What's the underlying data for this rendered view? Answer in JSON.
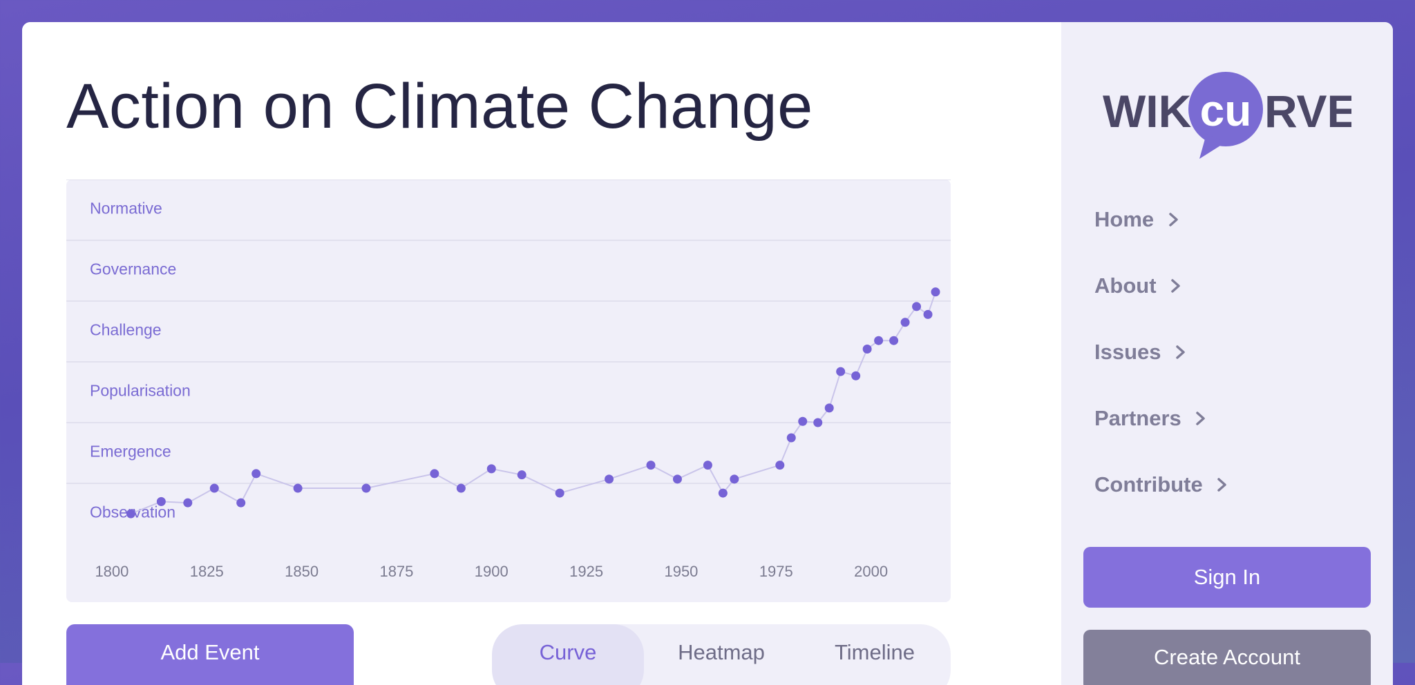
{
  "page": {
    "title": "Action on Climate Change"
  },
  "brand": {
    "logo_left": "WIKI",
    "logo_right": "RVE",
    "logo_mark": "cu",
    "accent": "#7a6bd3",
    "dark": "#4b4766"
  },
  "sidebar": {
    "nav": [
      {
        "label": "Home",
        "icon": "chevron-right-icon"
      },
      {
        "label": "About",
        "icon": "chevron-right-icon"
      },
      {
        "label": "Issues",
        "icon": "chevron-right-icon"
      },
      {
        "label": "Partners",
        "icon": "chevron-right-icon"
      },
      {
        "label": "Contribute",
        "icon": "chevron-right-icon"
      }
    ],
    "sign_in": "Sign In",
    "create_account": "Create Account"
  },
  "actions": {
    "add_event": "Add Event",
    "views": [
      "Curve",
      "Heatmap",
      "Timeline"
    ],
    "active_view": "Curve"
  },
  "chart_data": {
    "type": "line",
    "title": "",
    "xlabel": "",
    "ylabel": "",
    "xlim": [
      1788,
      2021
    ],
    "x_ticks": [
      1800,
      1825,
      1850,
      1875,
      1900,
      1925,
      1950,
      1975,
      2000
    ],
    "ylim": [
      -0.5,
      5.5
    ],
    "bands": [
      "Observation",
      "Emergence",
      "Popularisation",
      "Challenge",
      "Governance",
      "Normative"
    ],
    "grid": true,
    "series": [
      {
        "points": [
          [
            1805,
            0.0
          ],
          [
            1813,
            0.2
          ],
          [
            1820,
            0.18
          ],
          [
            1827,
            0.42
          ],
          [
            1834,
            0.18
          ],
          [
            1838,
            0.66
          ],
          [
            1849,
            0.42
          ],
          [
            1867,
            0.42
          ],
          [
            1885,
            0.66
          ],
          [
            1892,
            0.42
          ],
          [
            1900,
            0.74
          ],
          [
            1908,
            0.64
          ],
          [
            1918,
            0.34
          ],
          [
            1931,
            0.57
          ],
          [
            1942,
            0.8
          ],
          [
            1949,
            0.57
          ],
          [
            1957,
            0.8
          ],
          [
            1961,
            0.34
          ],
          [
            1964,
            0.57
          ],
          [
            1976,
            0.8
          ],
          [
            1979,
            1.25
          ],
          [
            1982,
            1.52
          ],
          [
            1986,
            1.5
          ],
          [
            1989,
            1.74
          ],
          [
            1992,
            2.34
          ],
          [
            1996,
            2.27
          ],
          [
            1999,
            2.71
          ],
          [
            2002,
            2.85
          ],
          [
            2006,
            2.85
          ],
          [
            2009,
            3.15
          ],
          [
            2012,
            3.41
          ],
          [
            2015,
            3.28
          ],
          [
            2017,
            3.65
          ]
        ]
      }
    ]
  }
}
